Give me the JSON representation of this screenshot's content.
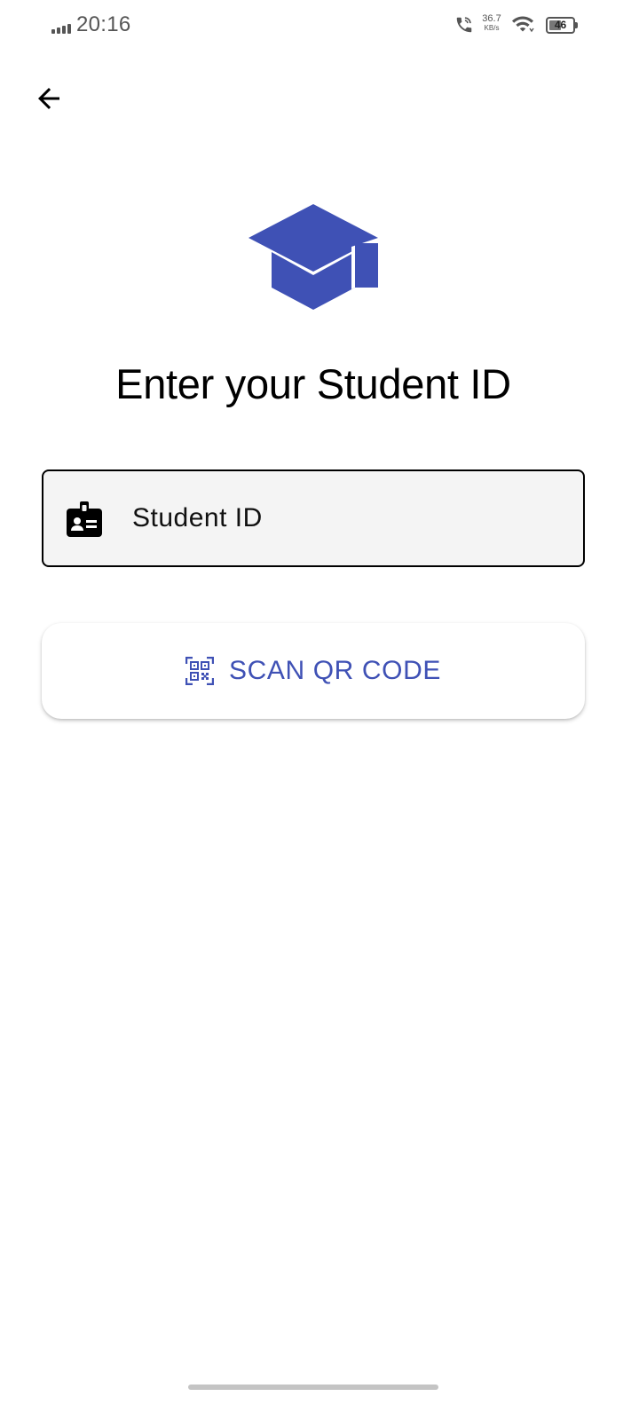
{
  "status_bar": {
    "time": "20:16",
    "net_speed_value": "36.7",
    "net_speed_unit": "KB/s",
    "battery_level": "46",
    "icons": [
      "signal-icon",
      "wifi-calling-icon",
      "wifi-icon",
      "battery-icon"
    ]
  },
  "header": {
    "back_icon": "arrow-left-icon"
  },
  "logo": {
    "icon": "graduation-cap-icon",
    "color": "#3f51b5"
  },
  "main": {
    "title": "Enter your Student ID",
    "student_id_field": {
      "placeholder": "Student ID",
      "value": "",
      "icon": "badge-id-icon"
    },
    "scan_button": {
      "label": "SCAN QR CODE",
      "icon": "qr-code-scan-icon"
    }
  },
  "colors": {
    "accent": "#3f51b5",
    "field_background": "#f4f4f4",
    "text": "#000000"
  }
}
